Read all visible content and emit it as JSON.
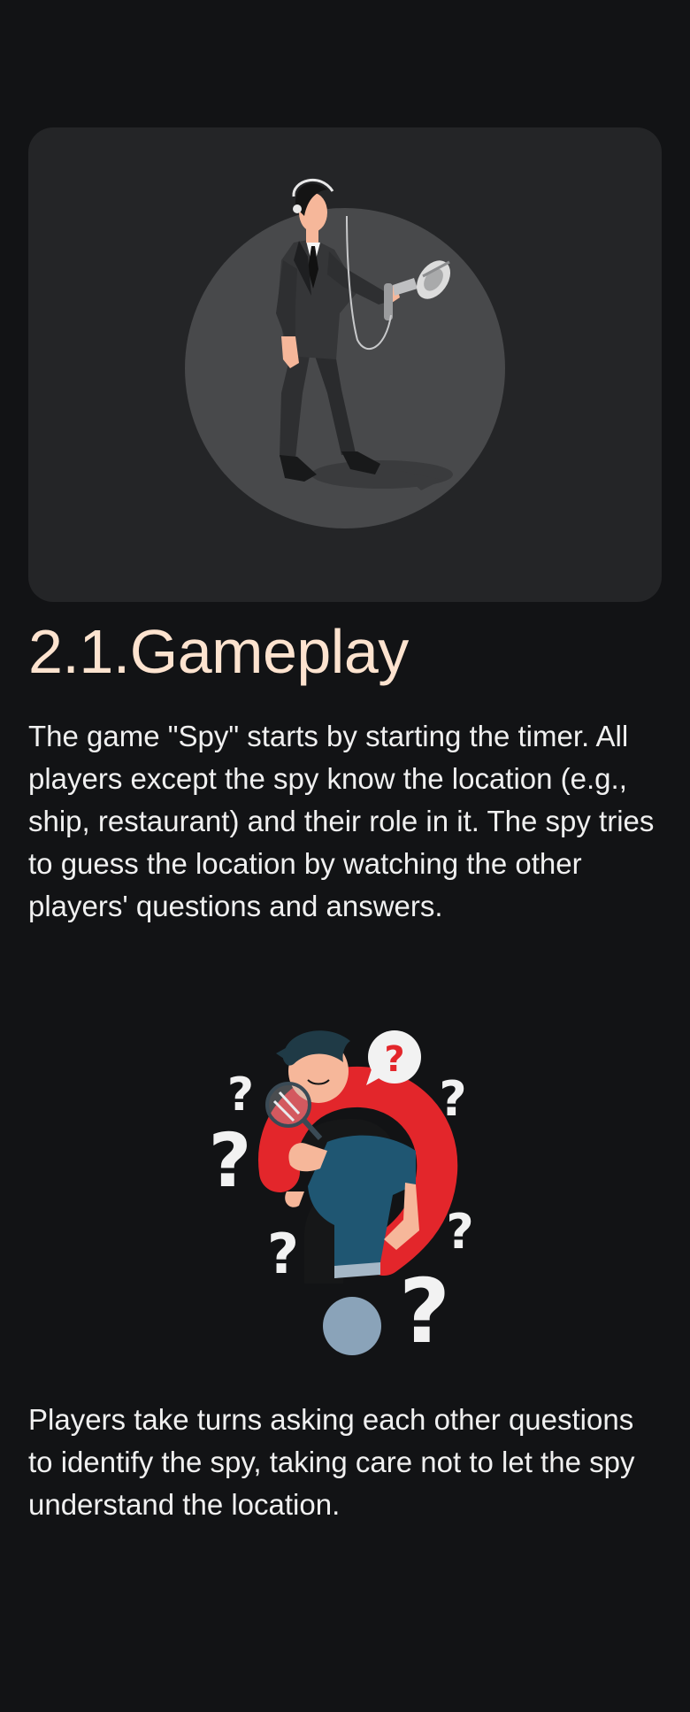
{
  "section": {
    "title": "2.1.Gameplay"
  },
  "paragraphs": {
    "intro": "The game \"Spy\" starts by starting the timer. All players except the spy know the location (e.g., ship, restaurant) and their role in it. The spy tries to guess the location by watching the other players' questions and answers.",
    "turns": "Players take turns asking each other questions to identify the spy, taking care not to let the spy understand the location."
  },
  "illustrations": {
    "spy_icon": "spy-listening-device-illustration",
    "question_icon": "thinking-person-question-marks-illustration"
  },
  "colors": {
    "background": "#121315",
    "card": "#242527",
    "title": "#fde3cf",
    "text": "#f0f0f0",
    "accent_red": "#e3262b",
    "shirt_blue": "#1f5672"
  }
}
